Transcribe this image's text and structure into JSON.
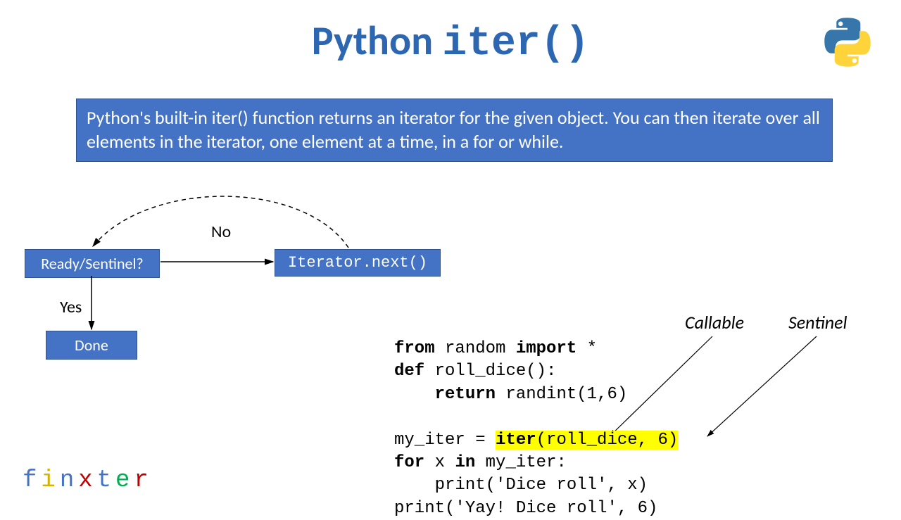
{
  "title": {
    "prefix": "Python ",
    "func": "iter()"
  },
  "description": "Python's built-in iter() function returns an iterator for the given object. You can then iterate over all elements in the iterator, one element at a time, in a for or while.",
  "flow": {
    "ready": "Ready/Sentinel?",
    "iterator": "Iterator.next()",
    "done": "Done",
    "no": "No",
    "yes": "Yes"
  },
  "labels": {
    "callable": "Callable",
    "sentinel": "Sentinel"
  },
  "code": {
    "l1a": "from",
    "l1b": " random ",
    "l1c": "import",
    "l1d": " *",
    "l2a": "def",
    "l2b": " roll_dice():",
    "l3a": "    ",
    "l3b": "return",
    "l3c": " randint(1,6)",
    "l4": "",
    "l5a": "my_iter = ",
    "l5b": "iter",
    "l5c": "(roll_dice, 6)",
    "l6a": "for",
    "l6b": " x ",
    "l6c": "in",
    "l6d": " my_iter:",
    "l7": "    print('Dice roll', x)",
    "l8": "print('Yay! Dice roll', 6)"
  },
  "brand": [
    "f",
    "i",
    "n",
    "x",
    "t",
    "e",
    "r"
  ]
}
